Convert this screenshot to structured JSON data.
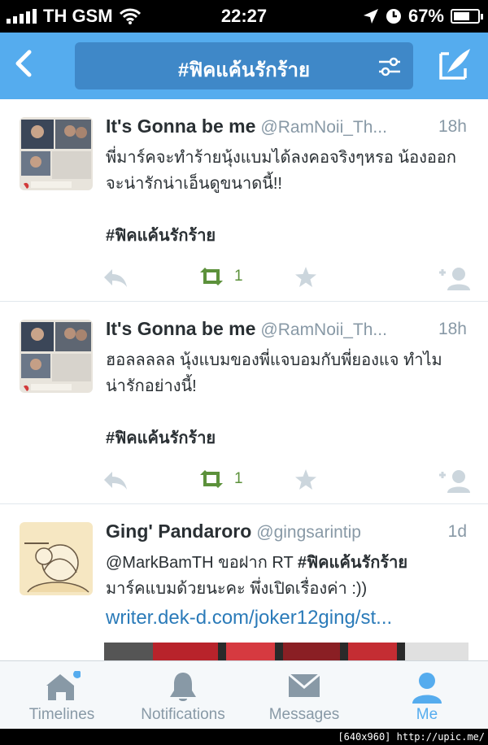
{
  "status_bar": {
    "carrier": "TH GSM",
    "time": "22:27",
    "battery": "67%",
    "battery_level": 0.67
  },
  "nav": {
    "title": "#ฟิคแค้นรักร้าย"
  },
  "tweets": [
    {
      "name": "It's Gonna be me",
      "handle": "@RamNoii_Th...",
      "time": "18h",
      "text_line1": "พี่มาร์คจะทำร้ายนุ้งแบมได้ลงคอจริงๆหรอ น้องออก",
      "text_line2": "จะน่ารักน่าเอ็นดูขนาดนี้!!",
      "hashtag": "#ฟิคแค้นรักร้าย",
      "retweets": "1"
    },
    {
      "name": "It's Gonna be me",
      "handle": "@RamNoii_Th...",
      "time": "18h",
      "text_line1": "ฮอลลลลล นุ้งแบมของพี่แจบอมกับพี่ยองแจ ทำไม",
      "text_line2": "น่ารักอย่างนี้!",
      "hashtag": "#ฟิคแค้นรักร้าย",
      "retweets": "1"
    },
    {
      "name": "Ging' Pandaroro",
      "handle": "@gingsarintip",
      "time": "1d",
      "mention": "@MarkBamTH",
      "text_mid": " ขอฝาก RT ",
      "hashtag": "#ฟิคแค้นรักร้าย",
      "text_line2": "มาร์คแบมด้วยนะคะ พึ่งเปิดเรื่องค่า :))",
      "link": "writer.dek-d.com/joker12ging/st..."
    }
  ],
  "tabs": [
    {
      "label": "Timelines",
      "icon": "home-icon"
    },
    {
      "label": "Notifications",
      "icon": "bell-icon"
    },
    {
      "label": "Messages",
      "icon": "envelope-icon"
    },
    {
      "label": "Me",
      "icon": "person-icon"
    }
  ],
  "watermark": "[640x960] http://upic.me/",
  "colors": {
    "accent": "#55acee",
    "retweet": "#5c913b",
    "secondary_text": "#8899a6",
    "link": "#2b7bb9"
  }
}
